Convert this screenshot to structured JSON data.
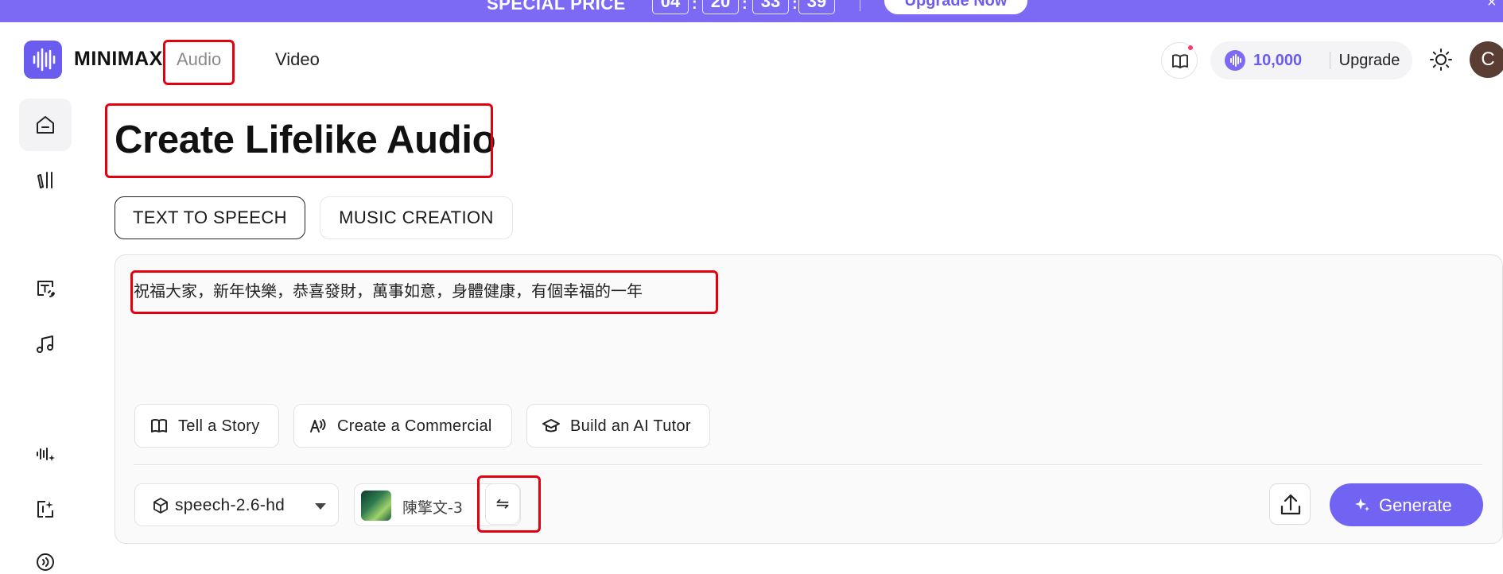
{
  "promo": {
    "title": "SPECIAL PRICE",
    "countdown": [
      "04",
      "20",
      "33",
      "39"
    ],
    "cta": "Upgrade Now",
    "close": "×"
  },
  "header": {
    "brand": "MINIMAX",
    "nav": [
      "Audio",
      "Video"
    ],
    "active_nav": "Audio",
    "credits": "10,000",
    "upgrade": "Upgrade",
    "avatar_initial": "C"
  },
  "sidebar": {
    "icons": [
      "home-icon",
      "library-icon",
      "text-to-speech-icon",
      "music-icon",
      "voice-clone-icon",
      "voice-design-icon",
      "audio-stream-icon"
    ],
    "active": "home-icon"
  },
  "main": {
    "title": "Create Lifelike Audio",
    "tabs": [
      "TEXT TO SPEECH",
      "MUSIC CREATION"
    ],
    "active_tab": "TEXT TO SPEECH",
    "input_text": "祝福大家，新年快樂，恭喜發財，萬事如意，身體健康，有個幸福的一年",
    "prompt_chips": [
      "Tell a Story",
      "Create a Commercial",
      "Build an AI Tutor"
    ],
    "model": "speech-2.6-hd",
    "voice": "陳擎文-3",
    "swap_symbol": "⇋",
    "generate": "Generate"
  },
  "colors": {
    "brand": "#6b5cf0",
    "promo": "#7c6af5",
    "highlight": "#e3000f",
    "generate": "#7264f3"
  }
}
